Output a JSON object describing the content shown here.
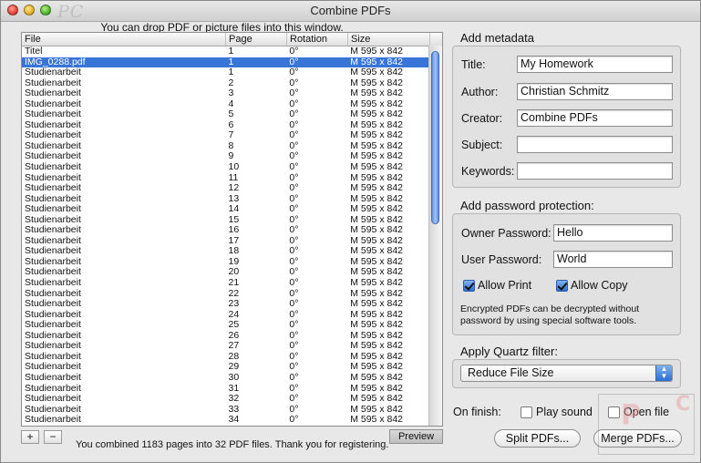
{
  "window": {
    "title": "Combine PDFs",
    "watermark": "PC"
  },
  "hint": "You can drop PDF or picture files into this window.",
  "list": {
    "columns": [
      "File",
      "Page",
      "Rotation",
      "Size"
    ],
    "rows": [
      [
        "Titel",
        "1",
        "0°",
        "M 595 x 842"
      ],
      [
        "IMG_0288.pdf",
        "1",
        "0°",
        "M 595 x 842"
      ],
      [
        "Studienarbeit",
        "1",
        "0°",
        "M 595 x 842"
      ],
      [
        "Studienarbeit",
        "2",
        "0°",
        "M 595 x 842"
      ],
      [
        "Studienarbeit",
        "3",
        "0°",
        "M 595 x 842"
      ],
      [
        "Studienarbeit",
        "4",
        "0°",
        "M 595 x 842"
      ],
      [
        "Studienarbeit",
        "5",
        "0°",
        "M 595 x 842"
      ],
      [
        "Studienarbeit",
        "6",
        "0°",
        "M 595 x 842"
      ],
      [
        "Studienarbeit",
        "7",
        "0°",
        "M 595 x 842"
      ],
      [
        "Studienarbeit",
        "8",
        "0°",
        "M 595 x 842"
      ],
      [
        "Studienarbeit",
        "9",
        "0°",
        "M 595 x 842"
      ],
      [
        "Studienarbeit",
        "10",
        "0°",
        "M 595 x 842"
      ],
      [
        "Studienarbeit",
        "11",
        "0°",
        "M 595 x 842"
      ],
      [
        "Studienarbeit",
        "12",
        "0°",
        "M 595 x 842"
      ],
      [
        "Studienarbeit",
        "13",
        "0°",
        "M 595 x 842"
      ],
      [
        "Studienarbeit",
        "14",
        "0°",
        "M 595 x 842"
      ],
      [
        "Studienarbeit",
        "15",
        "0°",
        "M 595 x 842"
      ],
      [
        "Studienarbeit",
        "16",
        "0°",
        "M 595 x 842"
      ],
      [
        "Studienarbeit",
        "17",
        "0°",
        "M 595 x 842"
      ],
      [
        "Studienarbeit",
        "18",
        "0°",
        "M 595 x 842"
      ],
      [
        "Studienarbeit",
        "19",
        "0°",
        "M 595 x 842"
      ],
      [
        "Studienarbeit",
        "20",
        "0°",
        "M 595 x 842"
      ],
      [
        "Studienarbeit",
        "21",
        "0°",
        "M 595 x 842"
      ],
      [
        "Studienarbeit",
        "22",
        "0°",
        "M 595 x 842"
      ],
      [
        "Studienarbeit",
        "23",
        "0°",
        "M 595 x 842"
      ],
      [
        "Studienarbeit",
        "24",
        "0°",
        "M 595 x 842"
      ],
      [
        "Studienarbeit",
        "25",
        "0°",
        "M 595 x 842"
      ],
      [
        "Studienarbeit",
        "26",
        "0°",
        "M 595 x 842"
      ],
      [
        "Studienarbeit",
        "27",
        "0°",
        "M 595 x 842"
      ],
      [
        "Studienarbeit",
        "28",
        "0°",
        "M 595 x 842"
      ],
      [
        "Studienarbeit",
        "29",
        "0°",
        "M 595 x 842"
      ],
      [
        "Studienarbeit",
        "30",
        "0°",
        "M 595 x 842"
      ],
      [
        "Studienarbeit",
        "31",
        "0°",
        "M 595 x 842"
      ],
      [
        "Studienarbeit",
        "32",
        "0°",
        "M 595 x 842"
      ],
      [
        "Studienarbeit",
        "33",
        "0°",
        "M 595 x 842"
      ],
      [
        "Studienarbeit",
        "34",
        "0°",
        "M 595 x 842"
      ]
    ],
    "selected_row": 1
  },
  "bottom": {
    "add_label": "+",
    "remove_label": "−",
    "status": "You combined 1183 pages into 32 PDF files. Thank you for registering.",
    "preview_label": "Preview"
  },
  "metadata": {
    "title": "Add metadata",
    "title_label": "Title:",
    "title_value": "My Homework",
    "author_label": "Author:",
    "author_value": "Christian Schmitz",
    "creator_label": "Creator:",
    "creator_value": "Combine PDFs",
    "subject_label": "Subject:",
    "subject_value": "",
    "keywords_label": "Keywords:",
    "keywords_value": ""
  },
  "password": {
    "title": "Add password protection:",
    "owner_label": "Owner Password:",
    "owner_value": "Hello",
    "user_label": "User Password:",
    "user_value": "World",
    "allow_print_label": "Allow Print",
    "allow_print": true,
    "allow_copy_label": "Allow Copy",
    "allow_copy": true,
    "note": "Encrypted PDFs can be decrypted without password by using special software tools."
  },
  "quartz": {
    "title": "Apply Quartz filter:",
    "selected": "Reduce File Size"
  },
  "finish": {
    "label": "On finish:",
    "play_sound_label": "Play sound",
    "play_sound": false,
    "open_file_label": "Open file",
    "open_file": false
  },
  "actions": {
    "split_label": "Split PDFs...",
    "merge_label": "Merge PDFs..."
  },
  "colors": {
    "selection": "#3875d7",
    "accent": "#2f6fd0"
  }
}
